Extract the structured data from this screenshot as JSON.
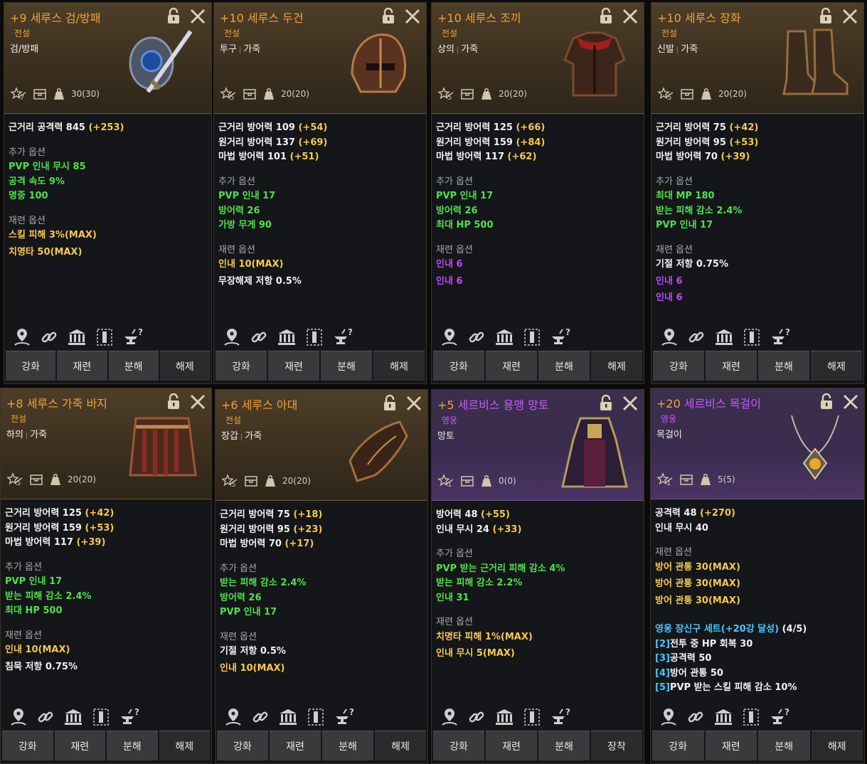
{
  "cards": [
    {
      "title_plus": "+9",
      "title_name": "세루스 검/방패",
      "grade": "전설",
      "type": [
        "검/방패"
      ],
      "enhance": "7",
      "durability": "30(30)",
      "main_stats": [
        {
          "label": "근거리 공격력 845",
          "bonus": "(+253)"
        }
      ],
      "extra_title": "추가 옵션",
      "extra": [
        "PVP 인내 무시 85",
        "공격 속도 9%",
        "명중 100"
      ],
      "refine_title": "재련 옵션",
      "refine": [
        {
          "text": "스킬 피해 3%(MAX)",
          "color": "y"
        },
        {
          "text": "치명타 50(MAX)",
          "color": "y"
        }
      ],
      "buttons": [
        "강화",
        "재련",
        "분해",
        "해제"
      ],
      "art": "sword-shield"
    },
    {
      "title_plus": "+10",
      "title_name": "세루스 두건",
      "grade": "전설",
      "type": [
        "투구",
        "가죽"
      ],
      "enhance": "5",
      "durability": "20(20)",
      "main_stats": [
        {
          "label": "근거리 방어력 109",
          "bonus": "(+54)"
        },
        {
          "label": "원거리 방어력 137",
          "bonus": "(+69)"
        },
        {
          "label": "마법 방어력 101",
          "bonus": "(+51)"
        }
      ],
      "extra_title": "추가 옵션",
      "extra": [
        "PVP 인내 17",
        "방어력 26",
        "가방 무게 90"
      ],
      "refine_title": "재련 옵션",
      "refine": [
        {
          "text": "인내 10(MAX)",
          "color": "y"
        },
        {
          "text": "무장해제 저항 0.5%",
          "color": "w"
        }
      ],
      "buttons": [
        "강화",
        "재련",
        "분해",
        "해제"
      ],
      "art": "helmet"
    },
    {
      "title_plus": "+10",
      "title_name": "세루스 조끼",
      "grade": "전설",
      "type": [
        "상의",
        "가죽"
      ],
      "enhance": "5",
      "durability": "20(20)",
      "main_stats": [
        {
          "label": "근거리 방어력 125",
          "bonus": "(+66)"
        },
        {
          "label": "원거리 방어력 159",
          "bonus": "(+84)"
        },
        {
          "label": "마법 방어력 117",
          "bonus": "(+62)"
        }
      ],
      "extra_title": "추가 옵션",
      "extra": [
        "PVP 인내 17",
        "방어력 26",
        "최대 HP 500"
      ],
      "refine_title": "재련 옵션",
      "refine": [
        {
          "text": "인내 6",
          "color": "p"
        },
        {
          "text": "인내 6",
          "color": "p"
        }
      ],
      "buttons": [
        "강화",
        "재련",
        "분해",
        "해제"
      ],
      "art": "vest"
    },
    {
      "title_plus": "+10",
      "title_name": "세루스 장화",
      "grade": "전설",
      "type": [
        "신발",
        "가죽"
      ],
      "enhance": "5",
      "durability": "20(20)",
      "main_stats": [
        {
          "label": "근거리 방어력 75",
          "bonus": "(+42)"
        },
        {
          "label": "원거리 방어력 95",
          "bonus": "(+53)"
        },
        {
          "label": "마법 방어력 70",
          "bonus": "(+39)"
        }
      ],
      "extra_title": "추가 옵션",
      "extra": [
        "최대 MP 180",
        "받는 피해 감소 2.4%",
        "PVP 인내 17"
      ],
      "refine_title": "재련 옵션",
      "refine": [
        {
          "text": "기절 저항 0.75%",
          "color": "w"
        },
        {
          "text": "인내 6",
          "color": "p"
        },
        {
          "text": "인내 6",
          "color": "p"
        }
      ],
      "buttons": [
        "강화",
        "재련",
        "분해",
        "해제"
      ],
      "art": "boots"
    },
    {
      "title_plus": "+8",
      "title_name": "세루스 가죽 바지",
      "grade": "전설",
      "type": [
        "하의",
        "가죽"
      ],
      "enhance": "5",
      "durability": "20(20)",
      "main_stats": [
        {
          "label": "근거리 방어력 125",
          "bonus": "(+42)"
        },
        {
          "label": "원거리 방어력 159",
          "bonus": "(+53)"
        },
        {
          "label": "마법 방어력 117",
          "bonus": "(+39)"
        }
      ],
      "extra_title": "추가 옵션",
      "extra": [
        "PVP 인내 17",
        "받는 피해 감소 2.4%",
        "최대 HP 500"
      ],
      "refine_title": "재련 옵션",
      "refine": [
        {
          "text": "인내 10(MAX)",
          "color": "y"
        },
        {
          "text": "침묵 저항 0.75%",
          "color": "w"
        }
      ],
      "buttons": [
        "강화",
        "재련",
        "분해",
        "해제"
      ],
      "art": "pants"
    },
    {
      "title_plus": "+6",
      "title_name": "세루스 아대",
      "grade": "전설",
      "type": [
        "장갑",
        "가죽"
      ],
      "enhance": "5",
      "durability": "20(20)",
      "main_stats": [
        {
          "label": "근거리 방어력 75",
          "bonus": "(+18)"
        },
        {
          "label": "원거리 방어력 95",
          "bonus": "(+23)"
        },
        {
          "label": "마법 방어력 70",
          "bonus": "(+17)"
        }
      ],
      "extra_title": "추가 옵션",
      "extra": [
        "받는 피해 감소 2.4%",
        "방어력 26",
        "PVP 인내 17"
      ],
      "refine_title": "재련 옵션",
      "refine": [
        {
          "text": "기절 저항 0.5%",
          "color": "w"
        },
        {
          "text": "인내 10(MAX)",
          "color": "y"
        }
      ],
      "buttons": [
        "강화",
        "재련",
        "분해",
        "해제"
      ],
      "art": "gloves"
    },
    {
      "title_plus": "+5",
      "title_name": "세르비스 용맹 망토",
      "grade": "영웅",
      "type": [
        "망토"
      ],
      "enhance": "1",
      "durability": "0(0)",
      "main_stats": [
        {
          "label": "방어력 48",
          "bonus": "(+55)"
        },
        {
          "label": "인내 무시 24",
          "bonus": "(+33)"
        }
      ],
      "extra_title": "추가 옵션",
      "extra": [
        "PVP 받는 근거리 피해 감소 4%",
        "받는 피해 감소 2.2%",
        "인내 31"
      ],
      "refine_title": "재련 옵션",
      "refine": [
        {
          "text": "치명타 피해 1%(MAX)",
          "color": "y"
        },
        {
          "text": "인내 무시 5(MAX)",
          "color": "y"
        }
      ],
      "buttons": [
        "강화",
        "재련",
        "분해",
        "장착"
      ],
      "art": "cloak"
    },
    {
      "title_plus": "+20",
      "title_name": "세르비스 목걸이",
      "grade": "영웅",
      "type": [
        "목걸이"
      ],
      "enhance": "1",
      "durability": "5(5)",
      "main_stats": [
        {
          "label": "공격력 48",
          "bonus": "(+270)"
        },
        {
          "label": "인내 무시 40",
          "bonus": ""
        }
      ],
      "extra_title": "",
      "extra": [],
      "refine_title": "재련 옵션",
      "refine": [
        {
          "text": "방어 관통 30(MAX)",
          "color": "y"
        },
        {
          "text": "방어 관통 30(MAX)",
          "color": "y"
        },
        {
          "text": "방어 관통 30(MAX)",
          "color": "y"
        }
      ],
      "set_title": "영웅 장신구 세트(+20강 달성)",
      "set_count": "(4/5)",
      "set_lines": [
        {
          "tag": "[2]",
          "text": "전투 중 HP 회복 30"
        },
        {
          "tag": "[3]",
          "text": "공격력 50"
        },
        {
          "tag": "[4]",
          "text": "방어 관통 50"
        },
        {
          "tag": "[5]",
          "text": "PVP 받는 스킬 피해 감소 10%"
        }
      ],
      "buttons": [
        "강화",
        "재련",
        "분해",
        "해제"
      ],
      "art": "necklace"
    }
  ],
  "colors": {
    "legend": "#f2a23a",
    "hero": "#c45cff",
    "gold_value": "#f5c94a",
    "green_option": "#4be24a",
    "purple_option": "#c046ff"
  }
}
